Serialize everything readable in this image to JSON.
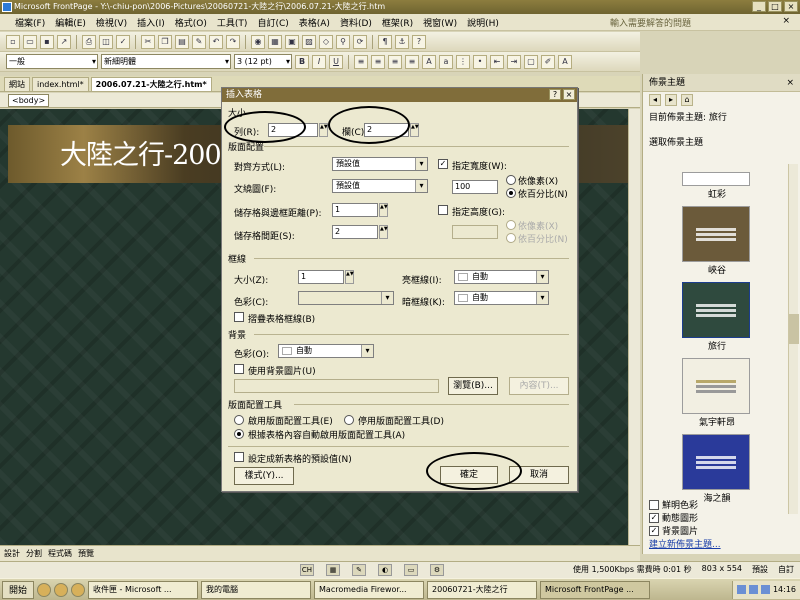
{
  "window": {
    "title": "Microsoft FrontPage - Y:\\-chiu-pon\\2006-Pictures\\20060721-大陸之行\\2006.07.21-大陸之行.htm",
    "controls": [
      "_",
      "□",
      "×"
    ]
  },
  "menu": {
    "items": [
      "檔案(F)",
      "編輯(E)",
      "檢視(V)",
      "插入(I)",
      "格式(O)",
      "工具(T)",
      "自訂(C)",
      "表格(A)",
      "資料(D)",
      "框架(R)",
      "視窗(W)",
      "說明(H)"
    ],
    "help_placeholder": "輸入需要解答的問題",
    "close": "×"
  },
  "toolbar": {
    "style_value": "一般",
    "font_value": "新細明體",
    "size_value": "3 (12 pt)",
    "bold": "B",
    "italic": "I",
    "underline": "U"
  },
  "doc_tabs": [
    "網站",
    "index.html*",
    "2006.07.21-大陸之行.htm*"
  ],
  "tag_selector": "<body>",
  "banner_title": "大陸之行-2006.",
  "view_tabs": [
    "設計",
    "分割",
    "程式碼",
    "預覽"
  ],
  "task_pane": {
    "title": "佈景主題",
    "close": "×",
    "current_theme": "目前佈景主題: 旅行",
    "select_label": "選取佈景主題",
    "themes": [
      {
        "name": "虹彩",
        "color": "#ffffff"
      },
      {
        "name": "峽谷",
        "color": "#6b5a3a"
      },
      {
        "name": "旅行",
        "color": "#2f4a3e"
      },
      {
        "name": "氣宇軒昂",
        "color": "#f2efe2"
      },
      {
        "name": "海之韻",
        "color": "#2a3a9a"
      }
    ],
    "options": [
      {
        "label": "鮮明色彩",
        "checked": false
      },
      {
        "label": "動態圖形",
        "checked": true
      },
      {
        "label": "背景圖片",
        "checked": true
      }
    ],
    "new_link": "建立新佈景主題..."
  },
  "status": {
    "speed": "使用 1,500Kbps 需費時 0:01 秒",
    "resolution": "803 x 554",
    "mode1": "預設",
    "mode2": "自訂"
  },
  "taskbar": {
    "start": "開始",
    "tasks": [
      "收件匣 - Microsoft ...",
      "我的電腦",
      "Macromedia Firewor...",
      "20060721-大陸之行",
      "Microsoft FrontPage ..."
    ],
    "time": "14:16"
  },
  "dialog": {
    "title": "插入表格",
    "help_btn": "?",
    "close_btn": "×",
    "size_group": "大小",
    "rows_label": "列(R):",
    "rows_value": "2",
    "cols_label": "欄(C):",
    "cols_value": "2",
    "layout_group": "版面配置",
    "align_label": "對齊方式(L):",
    "align_value": "預設值",
    "float_label": "文繞圖(F):",
    "float_value": "預設值",
    "padding_label": "儲存格與邊框距離(P):",
    "padding_value": "1",
    "spacing_label": "儲存格間距(S):",
    "spacing_value": "2",
    "spec_width_label": "指定寬度(W):",
    "spec_width_checked": true,
    "width_value": "100",
    "width_px_label": "依像素(X)",
    "width_pct_label": "依百分比(N)",
    "spec_height_label": "指定高度(G):",
    "height_px_label": "依像素(X)",
    "height_pct_label": "依百分比(N)",
    "borders_group": "框線",
    "border_size_label": "大小(Z):",
    "border_size_value": "1",
    "border_color_label": "色彩(C):",
    "light_border_label": "亮框線(I):",
    "light_border_value": "自動",
    "dark_border_label": "暗框線(K):",
    "dark_border_value": "自動",
    "collapse_label": "摺疊表格框線(B)",
    "bg_group": "背景",
    "bg_color_label": "色彩(O):",
    "bg_color_value": "自動",
    "bg_image_label": "使用背景圖片(U)",
    "browse_btn": "瀏覽(B)...",
    "props_btn": "內容(T)...",
    "layout_tools_group": "版面配置工具",
    "enable_tools_label": "啟用版面配置工具(E)",
    "disable_tools_label": "停用版面配置工具(D)",
    "auto_tools_label": "根據表格內容自動啟用版面配置工具(A)",
    "default_label": "設定成新表格的預設值(N)",
    "style_btn": "樣式(Y)...",
    "ok_btn": "確定",
    "cancel_btn": "取消"
  }
}
